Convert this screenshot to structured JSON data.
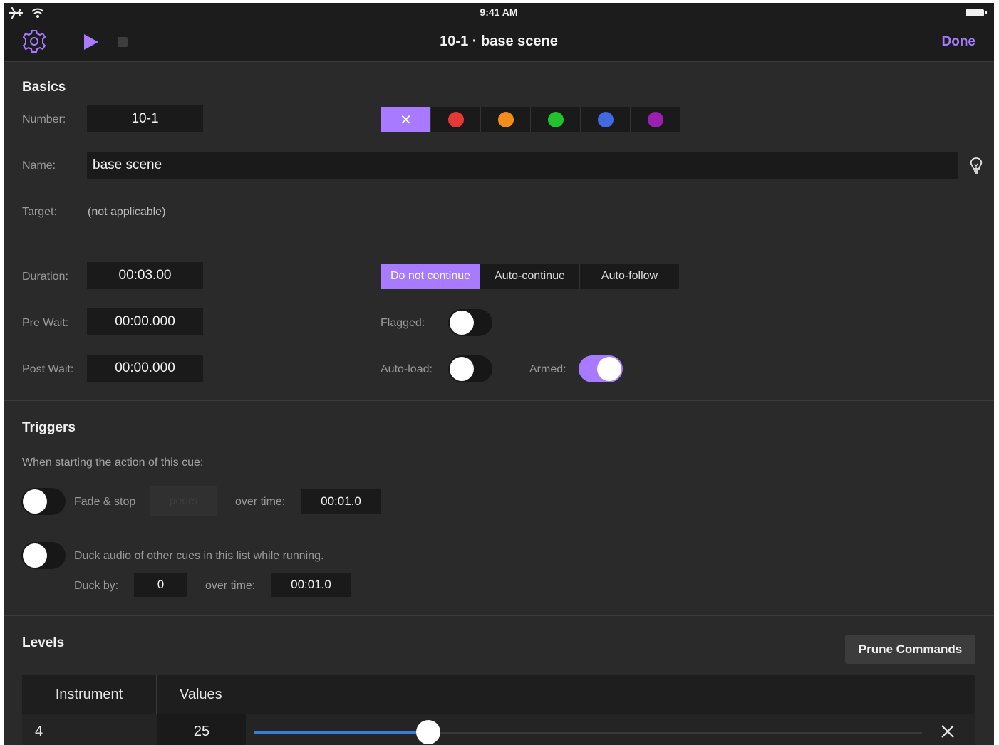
{
  "status": {
    "time": "9:41 AM"
  },
  "nav": {
    "title": "10-1 · base scene",
    "done_label": "Done"
  },
  "basics": {
    "title": "Basics",
    "number_label": "Number:",
    "number_value": "10-1",
    "name_label": "Name:",
    "name_value": "base scene",
    "target_label": "Target:",
    "target_value": "(not applicable)",
    "duration_label": "Duration:",
    "duration_value": "00:03.00",
    "prewait_label": "Pre Wait:",
    "prewait_value": "00:00.000",
    "postwait_label": "Post Wait:",
    "postwait_value": "00:00.000",
    "colors": {
      "none_glyph": "✕",
      "swatches": [
        "#e53935",
        "#f28c1b",
        "#22c22e",
        "#4169e1",
        "#9b1fb0"
      ],
      "selected": "none"
    },
    "continue_mode": {
      "options": [
        "Do not continue",
        "Auto-continue",
        "Auto-follow"
      ],
      "selected": "Do not continue"
    },
    "flagged_label": "Flagged:",
    "flagged": false,
    "autoload_label": "Auto-load:",
    "autoload": false,
    "armed_label": "Armed:",
    "armed": true
  },
  "triggers": {
    "title": "Triggers",
    "intro": "When starting the action of this cue:",
    "fade_stop_label": "Fade & stop",
    "fade_stop_enabled": false,
    "peers_value": "peers",
    "over_time_label": "over time:",
    "fade_time": "00:01.0",
    "duck_label": "Duck audio of other cues in this list while running.",
    "duck_enabled": false,
    "duck_by_label": "Duck by:",
    "duck_by_value": "0",
    "duck_over_time_label": "over time:",
    "duck_time": "00:01.0"
  },
  "levels": {
    "title": "Levels",
    "prune_label": "Prune Commands",
    "columns": [
      "Instrument",
      "Values"
    ],
    "rows": [
      {
        "instrument": "4",
        "value": "25",
        "fraction": 0.26
      }
    ]
  },
  "colors": {
    "accent": "#a77aff",
    "background": "#2a2a2a",
    "field": "#1a1a1a"
  }
}
